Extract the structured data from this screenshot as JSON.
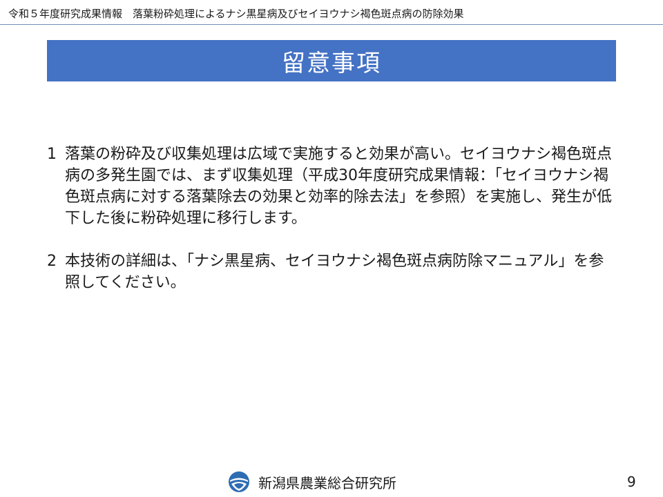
{
  "header": {
    "title": "令和５年度研究成果情報　落葉粉砕処理によるナシ黒星病及びセイヨウナシ褐色斑点病の防除効果"
  },
  "banner": {
    "title": "留意事項"
  },
  "notes": [
    {
      "num": "1",
      "text": "落葉の粉砕及び収集処理は広域で実施すると効果が高い。セイヨウナシ褐色斑点病の多発生園では、まず収集処理（平成30年度研究成果情報：「セイヨウナシ褐色斑点病に対する落葉除去の効果と効率的除去法」を参照）を実施し、発生が低下した後に粉砕処理に移行します。"
    },
    {
      "num": "2",
      "text": "本技術の詳細は、「ナシ黒星病、セイヨウナシ褐色斑点病防除マニュアル」を参照してください。"
    }
  ],
  "footer": {
    "org_name": "新潟県農業総合研究所",
    "page_number": "9",
    "logo_icon": "prefecture-emblem-icon"
  },
  "colors": {
    "banner_bg": "#4472c4",
    "banner_text": "#ffffff",
    "header_rule": "#6f8fb5",
    "logo_blue": "#2e6db4"
  }
}
